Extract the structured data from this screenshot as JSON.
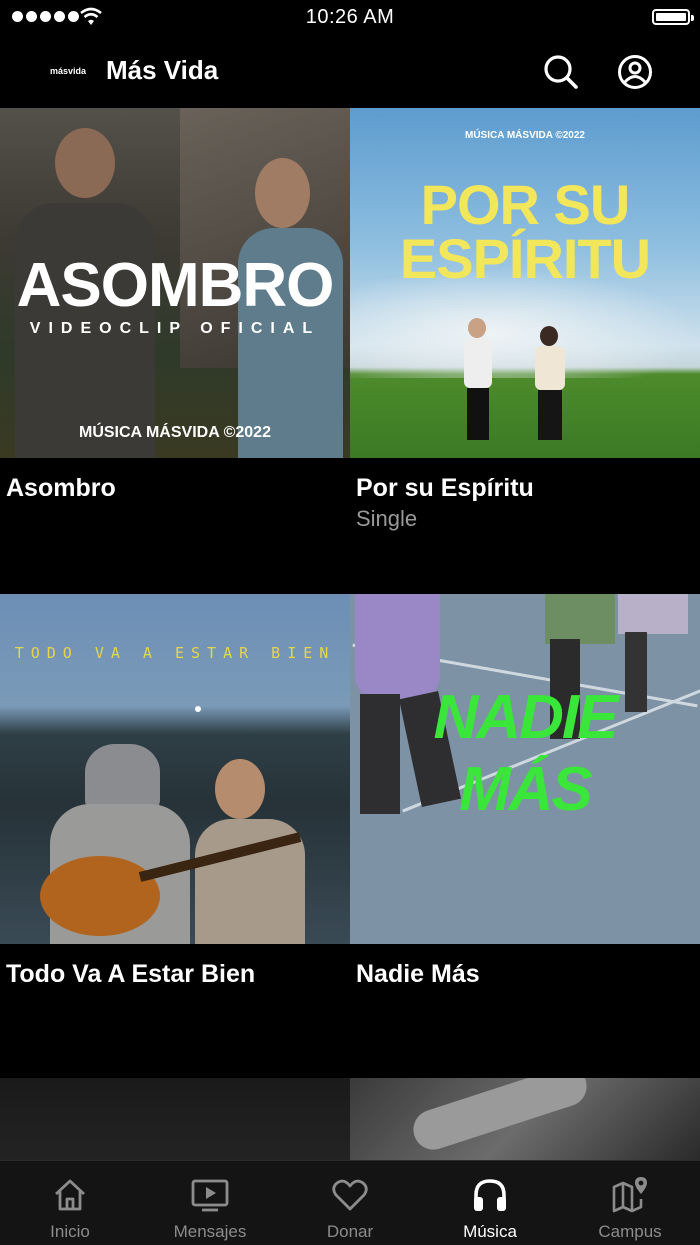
{
  "status_bar": {
    "time": "10:26 AM"
  },
  "header": {
    "logo_text": "másvida",
    "title": "Más Vida"
  },
  "albums": [
    {
      "title": "Asombro",
      "subtitle": "",
      "art_main": "ASOMBRO",
      "art_sub": "VIDEOCLIP OFICIAL",
      "art_footer": "MÚSICA MÁSVIDA ©2022"
    },
    {
      "title": "Por su Espíritu",
      "subtitle": "Single",
      "art_top": "MÚSICA MÁSVIDA ©2022",
      "art_line1": "POR SU",
      "art_line2": "ESPÍRITU"
    },
    {
      "title": "Todo Va A Estar Bien",
      "subtitle": "",
      "art_main": "TODO VA A ESTAR BIEN"
    },
    {
      "title": "Nadie Más",
      "subtitle": "",
      "art_line1": "NADIE",
      "art_line2": "MÁS"
    }
  ],
  "tabs": [
    {
      "label": "Inicio",
      "icon": "home-icon",
      "active": false
    },
    {
      "label": "Mensajes",
      "icon": "tv-play-icon",
      "active": false
    },
    {
      "label": "Donar",
      "icon": "heart-icon",
      "active": false
    },
    {
      "label": "Música",
      "icon": "headphones-icon",
      "active": true
    },
    {
      "label": "Campus",
      "icon": "map-pin-icon",
      "active": false
    }
  ],
  "colors": {
    "background": "#000000",
    "tabbar": "#141414",
    "inactive_tab": "#8c8c8c",
    "subtitle": "#9a9a9a",
    "yellow_art": "#f2e65a",
    "green_art": "#39e639"
  }
}
